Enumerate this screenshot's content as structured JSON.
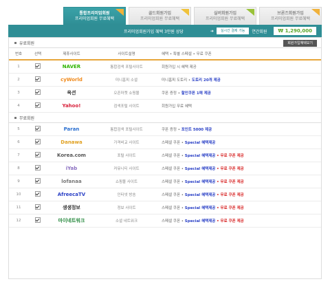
{
  "tabs": [
    {
      "line1": "통합프리미엄회원",
      "line2": "프리미엄회원 무료혜택",
      "flag": "#f0b13a",
      "active": true
    },
    {
      "line1": "골드회원가입",
      "line2": "프리미엄회원 무료혜택",
      "flag": "#f0c23a",
      "active": false
    },
    {
      "line1": "실버회원가입",
      "line2": "프리미엄회원 무료혜택",
      "flag": "#9ac23a",
      "active": false
    },
    {
      "line1": "브론즈회원가입",
      "line2": "프리미엄회원 무료혜택",
      "flag": "#f0b13a",
      "active": false
    }
  ],
  "summary": {
    "label": "프리미엄회원가입 혜택 3만원 상당",
    "account": "실시간 결제 가능",
    "account_sub": "연간회원",
    "won": "₩ 1,290,000"
  },
  "top_section": {
    "title": "유료회원",
    "button": "회원가입혜택보기"
  },
  "columns": {
    "no": "번호",
    "check": "선택",
    "logo": "제휴사이트",
    "desc": "사이트설명",
    "info": "혜택 • 특별 스페셜 • 무료 쿠폰"
  },
  "rows_a": [
    {
      "no": "1",
      "logo": "NAVER",
      "logo_color": "#2db400",
      "desc": "통합검색 포털사이트",
      "a": "회원가입 시 혜택 제공",
      "b": "",
      "c": ""
    },
    {
      "no": "2",
      "logo": "cyWorld",
      "logo_color": "#f08a1c",
      "desc": "미니홈피 소셜",
      "a": "미니홈피 도토리 •",
      "b": "도토리 20개 제공",
      "c": ""
    },
    {
      "no": "3",
      "logo": "옥션",
      "logo_color": "#333333",
      "desc": "오픈마켓 쇼핑몰",
      "a": "쿠폰 증정 •",
      "b": "할인쿠폰 1매 제공",
      "c": ""
    },
    {
      "no": "4",
      "logo": "Yahoo!",
      "logo_color": "#d8203a",
      "desc": "검색포털 사이트",
      "a": "회원가입 무료 혜택",
      "b": "",
      "c": ""
    }
  ],
  "sub_section": {
    "title": "무료회원"
  },
  "rows_b": [
    {
      "no": "5",
      "logo": "Paran",
      "logo_color": "#2a6fd0",
      "desc": "통합검색 포털사이트",
      "a": "쿠폰 증정 •",
      "b": "포인트 5000 제공",
      "c": ""
    },
    {
      "no": "6",
      "logo": "Danawa",
      "logo_color": "#e0a020",
      "desc": "가격비교 사이트",
      "a": "스페셜 쿠폰 •",
      "b": "Special 혜택제공",
      "c": ""
    },
    {
      "no": "7",
      "logo": "Korea.com",
      "logo_color": "#555555",
      "desc": "포털 사이트",
      "a": "스페셜 쿠폰 •",
      "b": "Special 혜택제공",
      "c": "• 무료 쿠폰 제공"
    },
    {
      "no": "8",
      "logo": "iYab",
      "logo_color": "#8a6fc0",
      "desc": "커뮤니티 사이트",
      "a": "스페셜 쿠폰 •",
      "b": "Special 혜택제공",
      "c": "• 무료 쿠폰 제공"
    },
    {
      "no": "9",
      "logo": "lofanaa",
      "logo_color": "#777777",
      "desc": "쇼핑몰 사이트",
      "a": "스페셜 쿠폰 •",
      "b": "Special 혜택제공",
      "c": "• 무료 쿠폰 제공"
    },
    {
      "no": "10",
      "logo": "AfreecaTV",
      "logo_color": "#2a40c6",
      "desc": "인터넷 방송",
      "a": "스페셜 쿠폰 •",
      "b": "Special 혜택제공",
      "c": "• 무료 쿠폰 제공"
    },
    {
      "no": "11",
      "logo": "생생정보",
      "logo_color": "#333333",
      "desc": "정보 사이트",
      "a": "스페셜 쿠폰 •",
      "b": "Special 혜택제공",
      "c": "• 무료 쿠폰 제공"
    },
    {
      "no": "12",
      "logo": "마이네트워크",
      "logo_color": "#2a8a40",
      "desc": "소셜 네트워크",
      "a": "스페셜 쿠폰 •",
      "b": "Special 혜택제공",
      "c": "• 무료 쿠폰 제공"
    }
  ]
}
